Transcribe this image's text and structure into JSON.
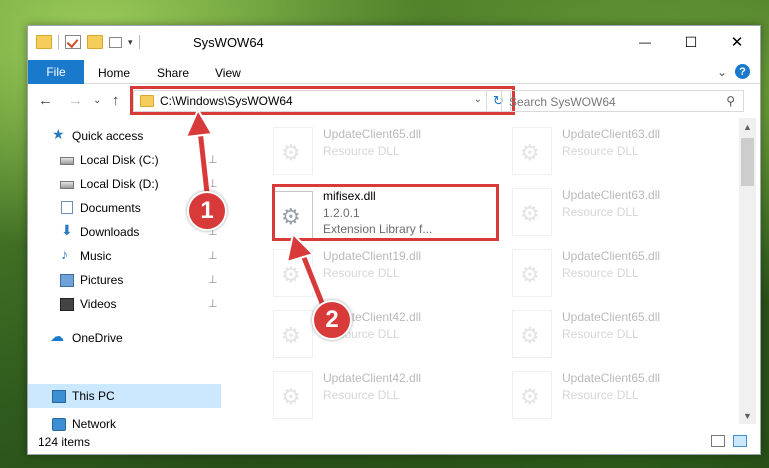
{
  "window": {
    "title": "SysWOW64",
    "minimize_glyph": "—",
    "maximize_glyph": "☐",
    "close_glyph": "✕"
  },
  "ribbon": {
    "file_tab": "File",
    "tabs": [
      "Home",
      "Share",
      "View"
    ],
    "expand_glyph": "⌄",
    "help_glyph": "?"
  },
  "nav": {
    "back_glyph": "←",
    "forward_glyph": "→",
    "recent_glyph": "⌄",
    "up_glyph": "↑"
  },
  "address": {
    "path": "C:\\Windows\\SysWOW64",
    "dropdown_glyph": "⌄",
    "refresh_glyph": "↻"
  },
  "search": {
    "placeholder": "Search SysWOW64",
    "icon_glyph": "⚲"
  },
  "navpane": {
    "items": [
      {
        "label": "Quick access",
        "icon": "star-icon",
        "glyph": "★",
        "pinned": false
      },
      {
        "label": "Local Disk (C:)",
        "icon": "drive-icon",
        "glyph": "",
        "pinned": true
      },
      {
        "label": "Local Disk (D:)",
        "icon": "drive-icon",
        "glyph": "",
        "pinned": true
      },
      {
        "label": "Documents",
        "icon": "documents-icon",
        "glyph": "",
        "pinned": true
      },
      {
        "label": "Downloads",
        "icon": "download-icon",
        "glyph": "⬇",
        "pinned": true
      },
      {
        "label": "Music",
        "icon": "music-icon",
        "glyph": "♪",
        "pinned": true
      },
      {
        "label": "Pictures",
        "icon": "pictures-icon",
        "glyph": "",
        "pinned": true
      },
      {
        "label": "Videos",
        "icon": "videos-icon",
        "glyph": "",
        "pinned": true
      },
      {
        "label": "OneDrive",
        "icon": "cloud-icon",
        "glyph": "☁",
        "pinned": false
      },
      {
        "label": "This PC",
        "icon": "computer-icon",
        "glyph": "",
        "pinned": false,
        "selected": true
      },
      {
        "label": "Network",
        "icon": "network-icon",
        "glyph": "",
        "pinned": false
      }
    ],
    "pin_glyph": "📌"
  },
  "files": [
    {
      "name": "UpdateClient65.dll",
      "line2": "Resource DLL",
      "line3": ""
    },
    {
      "name": "UpdateClient63.dll",
      "line2": "Resource DLL",
      "line3": ""
    },
    {
      "name": "mifisex.dll",
      "line2": "1.2.0.1",
      "line3": "Extension Library f..."
    },
    {
      "name": "UpdateClient63.dll",
      "line2": "Resource DLL",
      "line3": ""
    },
    {
      "name": "UpdateClient19.dll",
      "line2": "Resource DLL",
      "line3": ""
    },
    {
      "name": "UpdateClient65.dll",
      "line2": "Resource DLL",
      "line3": ""
    },
    {
      "name": "UpdateClient42.dll",
      "line2": "Resource DLL",
      "line3": ""
    },
    {
      "name": "UpdateClient65.dll",
      "line2": "Resource DLL",
      "line3": ""
    },
    {
      "name": "UpdateClient42.dll",
      "line2": "Resource DLL",
      "line3": ""
    },
    {
      "name": "UpdateClient65.dll",
      "line2": "Resource DLL",
      "line3": ""
    }
  ],
  "gear_glyph": "⚙",
  "status": {
    "item_count": "124 items"
  },
  "scrollbar": {
    "up_glyph": "▲",
    "down_glyph": "▼"
  },
  "callouts": [
    "1",
    "2"
  ],
  "colors": {
    "accent": "#1979ca",
    "highlight": "#d83a3a",
    "selection": "#cce8ff"
  }
}
